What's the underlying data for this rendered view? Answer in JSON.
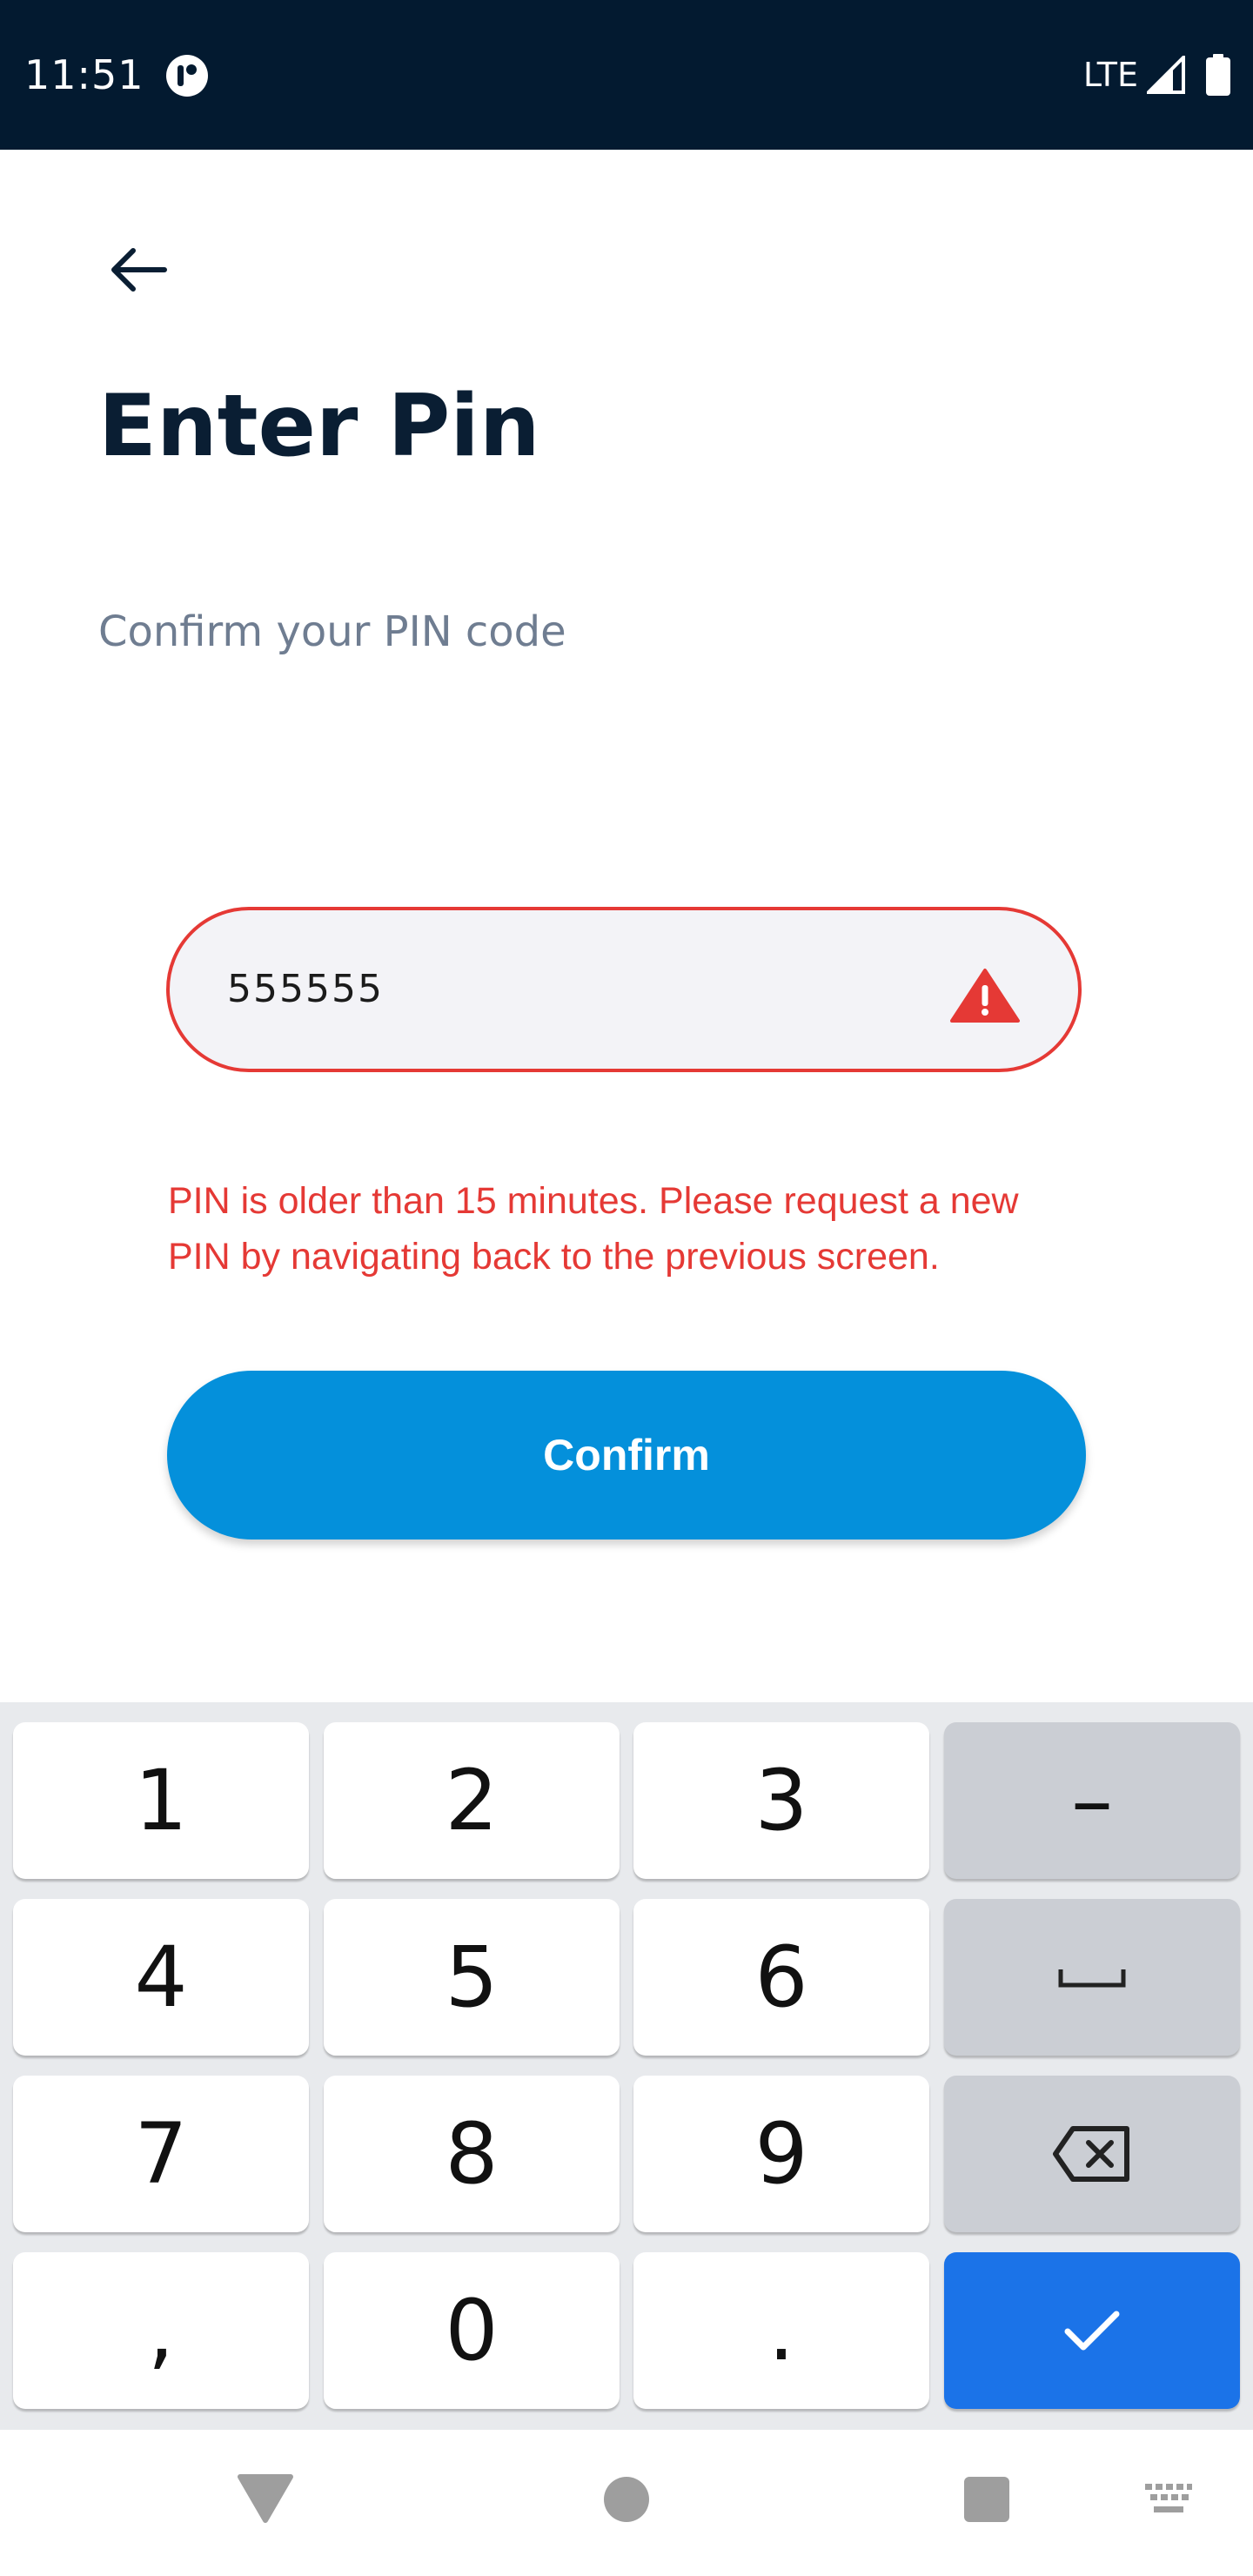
{
  "status_bar": {
    "time": "11:51",
    "network": "LTE"
  },
  "page": {
    "title": "Enter Pin",
    "subtitle": "Confirm your PIN code"
  },
  "pin_field": {
    "value": "555555",
    "state": "error"
  },
  "error_message": "PIN is older than 15 minutes. Please request a new PIN by navigating back to the previous screen.",
  "confirm_button": {
    "label": "Confirm"
  },
  "keyboard": {
    "keys": {
      "k1": "1",
      "k2": "2",
      "k3": "3",
      "minus": "–",
      "k4": "4",
      "k5": "5",
      "k6": "6",
      "k7": "7",
      "k8": "8",
      "k9": "9",
      "comma": ",",
      "k0": "0",
      "period": "."
    }
  },
  "colors": {
    "status_bar": "#031a30",
    "title": "#0a1e33",
    "error": "#e53935",
    "primary_button": "#0490db",
    "enter_key": "#1b73e8"
  },
  "icons": {
    "back": "arrow-left-icon",
    "warning": "warning-triangle-icon",
    "backspace": "backspace-icon",
    "enter": "checkmark-icon",
    "space": "space-bar-icon"
  }
}
